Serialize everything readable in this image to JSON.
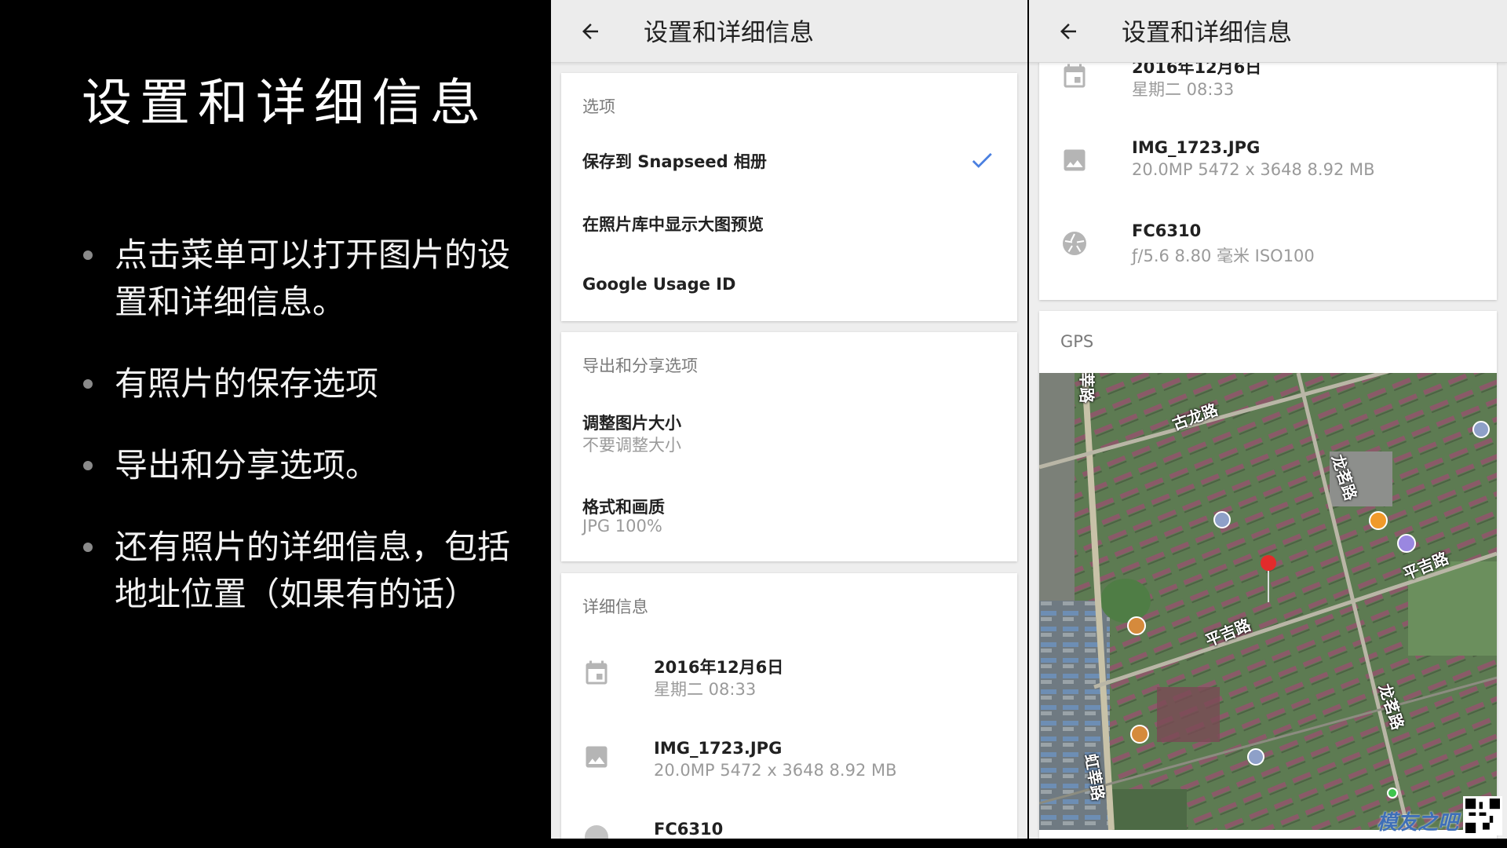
{
  "slide": {
    "title": "设置和详细信息",
    "bullets": [
      "点击菜单可以打开图片的设置和详细信息。",
      "有照片的保存选项",
      "导出和分享选项。",
      "还有照片的详细信息，包括地址位置（如果有的话）"
    ]
  },
  "app": {
    "title": "设置和详细信息",
    "back_icon": "arrow-back-icon",
    "accent_color": "#4a7fe0"
  },
  "options": {
    "header": "选项",
    "save_to_album": "保存到 Snapseed 相册",
    "save_to_album_checked": true,
    "large_preview": "在照片库中显示大图预览",
    "google_usage_id": "Google Usage ID"
  },
  "export": {
    "header": "导出和分享选项",
    "resize_title": "调整图片大小",
    "resize_value": "不要调整大小",
    "format_title": "格式和画质",
    "format_value": "JPG 100%"
  },
  "details": {
    "header": "详细信息",
    "date": "2016年12月6日",
    "datetime": "星期二 08:33",
    "filename": "IMG_1723.JPG",
    "file_info": "20.0MP   5472 x 3648   8.92 MB",
    "camera": "FC6310",
    "camera_info": "ƒ/5.6   8.80 毫米   ISO100"
  },
  "gps": {
    "header": "GPS",
    "roads": [
      "古龙路",
      "龙茗路",
      "平吉路",
      "平吉路",
      "龙茗路",
      "虹莘路",
      "莘路"
    ]
  },
  "watermark": {
    "text": "模友之吧"
  }
}
